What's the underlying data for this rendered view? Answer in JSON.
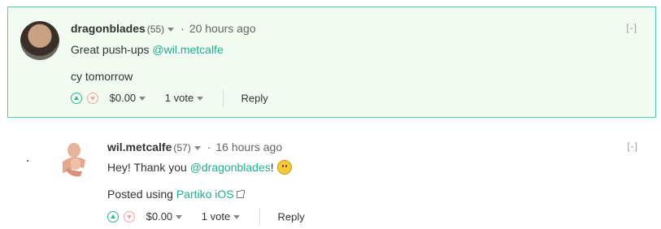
{
  "comments": [
    {
      "author": "dragonblades",
      "reputation": "(55)",
      "separator": "·",
      "time": "20 hours ago",
      "collapse": "[-]",
      "line1_text": "Great push-ups ",
      "line1_mention": "@wil.metcalfe",
      "line2_text": "cy tomorrow",
      "payout": "$0.00",
      "votes": "1 vote",
      "reply": "Reply"
    },
    {
      "author": "wil.metcalfe",
      "reputation": "(57)",
      "separator": "·",
      "time": "16 hours ago",
      "collapse": "[-]",
      "line1_text": "Hey! Thank you ",
      "line1_mention": "@dragonblades",
      "line1_suffix": "!",
      "line2_text": "Posted using ",
      "line2_link": "Partiko iOS",
      "payout": "$0.00",
      "votes": "1 vote",
      "reply": "Reply"
    }
  ],
  "colors": {
    "highlight_bg": "#f1fbf2",
    "highlight_border": "#4bd1a8",
    "link": "#1faf8f",
    "upvote": "#2fb58f",
    "downvote": "#f3a7a0"
  },
  "icons": [
    "upvote-icon",
    "downvote-icon",
    "caret-down-icon",
    "smiley-emoji-icon",
    "external-link-icon"
  ]
}
